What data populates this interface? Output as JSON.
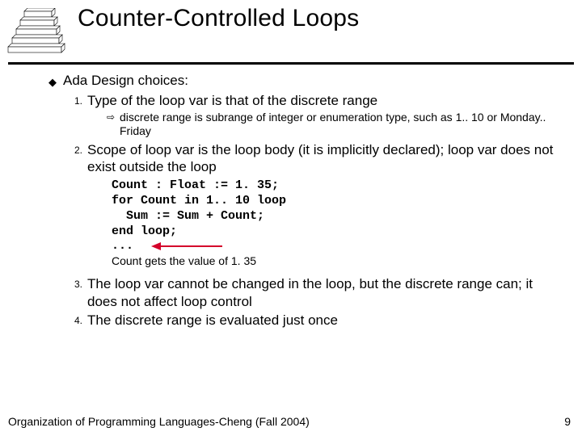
{
  "title": "Counter-Controlled Loops",
  "bullet_label": "Ada Design choices:",
  "items": [
    {
      "num": "1.",
      "text": "Type of the loop var is that of the discrete range",
      "sub": "discrete range is subrange of integer or enumeration type, such as 1.. 10 or Monday.. Friday"
    },
    {
      "num": "2.",
      "text": "Scope of loop var is the loop body (it is implicitly declared); loop var does not exist outside the loop"
    },
    {
      "num": "3.",
      "text": "The loop var cannot be changed in the loop, but the discrete range can; it does not affect loop control"
    },
    {
      "num": "4.",
      "text": "The discrete range is evaluated just once"
    }
  ],
  "code": "Count : Float := 1. 35;\nfor Count in 1.. 10 loop\n  Sum := Sum + Count;\nend loop;",
  "ellipsis": "...",
  "caption": "Count gets the value of 1. 35",
  "footer": "Organization of Programming Languages-Cheng (Fall 2004)",
  "page": "9"
}
